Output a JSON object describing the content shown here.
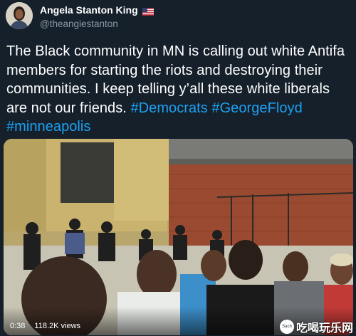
{
  "tweet": {
    "display_name": "Angela Stanton King",
    "handle": "@theangiestanton",
    "text_plain": "The Black community in MN is calling out white Antifa members for starting the riots and destroying their communities. I keep telling y’all these white liberals are not our friends.",
    "hashtags": [
      "#Democrats",
      "#GeorgeFloyd",
      "#minneapolis"
    ],
    "flag_icon": "us-flag-icon",
    "accent_color": "#1da1f2"
  },
  "video": {
    "time": "0:38",
    "views": "118.2K views"
  },
  "watermark": {
    "logo_text": "Sach",
    "text": "吃喝玩乐网"
  }
}
